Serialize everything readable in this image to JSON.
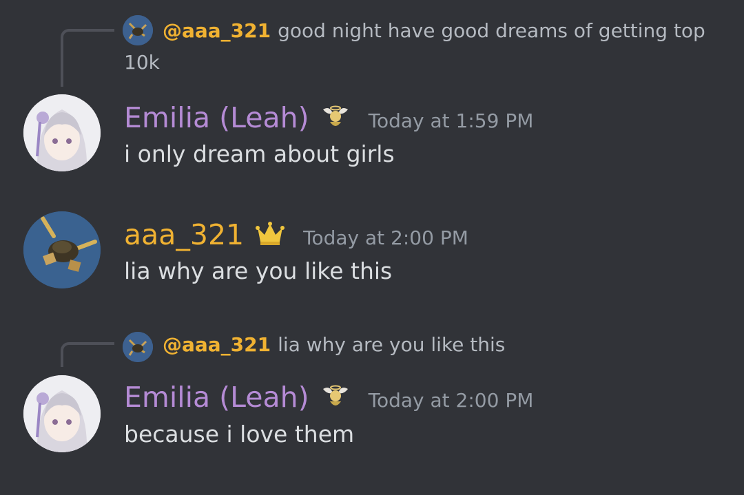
{
  "messages": [
    {
      "reply": {
        "mention": "@aaa_321",
        "text": "good night have good dreams of getting top 10k",
        "avatar_icon": "skydiver-avatar"
      },
      "author": "Emilia (Leah)",
      "author_color": "#b58bd5",
      "role_icon": "winged-angel-icon",
      "timestamp": "Today at 1:59 PM",
      "content": "i only dream about girls"
    },
    {
      "author": "aaa_321",
      "author_color": "#f0b232",
      "role_icon": "crown-icon",
      "timestamp": "Today at 2:00 PM",
      "content": "lia why are you like this"
    },
    {
      "reply": {
        "mention": "@aaa_321",
        "text": "lia why are you like this",
        "avatar_icon": "skydiver-avatar"
      },
      "author": "Emilia (Leah)",
      "author_color": "#b58bd5",
      "role_icon": "winged-angel-icon",
      "timestamp": "Today at 2:00 PM",
      "content": "because i love them"
    }
  ],
  "colors": {
    "background": "#313338",
    "mention": "#f0b232",
    "muted_text": "#949ba4"
  }
}
